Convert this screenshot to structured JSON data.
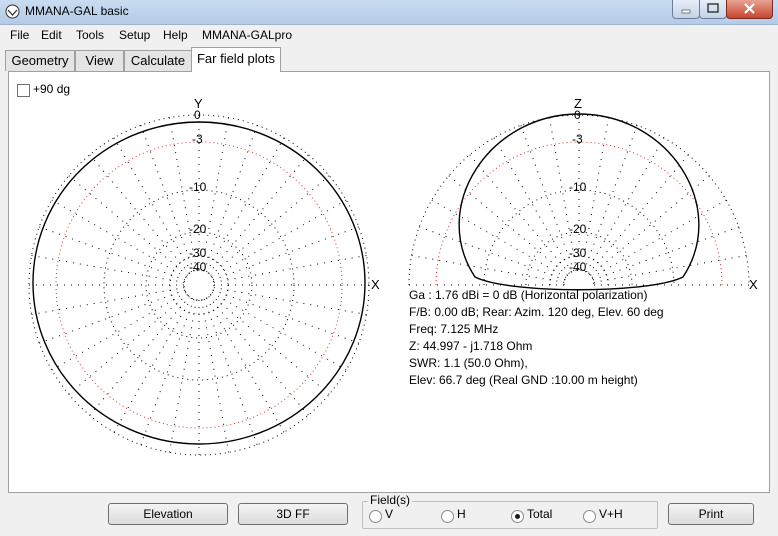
{
  "window": {
    "title": "MMANA-GAL basic"
  },
  "menu": [
    "File",
    "Edit",
    "Tools",
    "Setup",
    "Help",
    "MMANA-GALpro"
  ],
  "tabs": [
    "Geometry",
    "View",
    "Calculate",
    "Far field plots"
  ],
  "active_tab": "Far field plots",
  "plot_options": {
    "plus90_label": "+90 dg",
    "plus90_checked": false
  },
  "azimuth_plot": {
    "axis_top": "Y",
    "axis_right": "X",
    "ring_labels": [
      "0",
      "-3",
      "-10",
      "-20",
      "-30",
      "-40"
    ]
  },
  "elevation_plot": {
    "axis_top": "Z",
    "axis_right": "X",
    "ring_labels": [
      "0",
      "-3",
      "-10",
      "-20",
      "-30",
      "-40"
    ]
  },
  "results": {
    "ga": "Ga : 1.76 dBi = 0 dB  (Horizontal polarization)",
    "fb": "F/B: 0.00 dB; Rear: Azim. 120 deg,  Elev. 60 deg",
    "freq": "Freq: 7.125 MHz",
    "z": "Z: 44.997 - j1.718 Ohm",
    "swr": "SWR: 1.1 (50.0 Ohm),",
    "elev": "Elev: 66.7 deg (Real GND  :10.00 m height)"
  },
  "buttons": {
    "elevation": "Elevation",
    "ff3d": "3D FF",
    "print": "Print"
  },
  "fields": {
    "title": "Field(s)",
    "options": [
      "V",
      "H",
      "Total",
      "V+H"
    ],
    "selected": "Total"
  },
  "colors": {
    "ref_ring": "#e03030",
    "pattern": "#000000",
    "grid": "#000000"
  }
}
